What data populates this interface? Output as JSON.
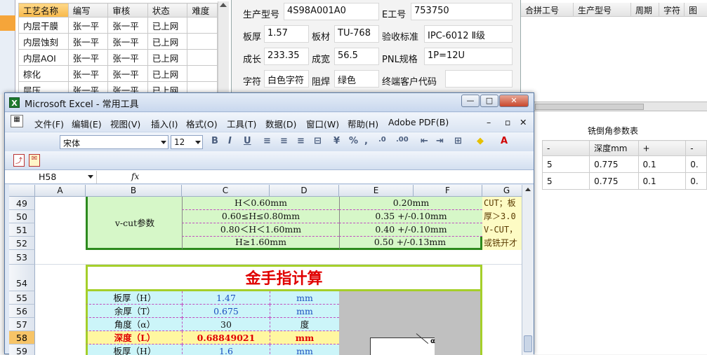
{
  "left_list": {
    "headers": [
      "工艺名称",
      "编写",
      "审核",
      "状态",
      "难度"
    ],
    "rows": [
      [
        "内层干膜",
        "张一平",
        "张一平",
        "已上网",
        ""
      ],
      [
        "内层蚀刻",
        "张一平",
        "张一平",
        "已上网",
        ""
      ],
      [
        "内层AOI",
        "张一平",
        "张一平",
        "已上网",
        ""
      ],
      [
        "棕化",
        "张一平",
        "张一平",
        "已上网",
        ""
      ],
      [
        "层压",
        "张一平",
        "张一平",
        "已上网",
        ""
      ]
    ]
  },
  "product_form": {
    "prod_no_label": "生产型号",
    "prod_no": "4S98A001A0",
    "e_no_label": "E工号",
    "e_no": "753750",
    "thickness_label": "板厚",
    "thickness": "1.57",
    "material_label": "板材",
    "material": "TU-768",
    "standard_label": "验收标准",
    "standard": "IPC-6012 Ⅱ级",
    "finished_label": "成长",
    "finished": "233.35",
    "width_label": "成宽",
    "width": "56.5",
    "pnl_label": "PNL规格",
    "pnl": "1P=12U",
    "char_label": "字符",
    "char": "白色字符",
    "mask_label": "阻焊",
    "mask": "绿色",
    "customer_label": "终端客户代码",
    "customer": ""
  },
  "right_panel": {
    "headers": [
      "合拼工号",
      "生产型号",
      "周期",
      "字符",
      "图"
    ],
    "table2_title": "铣倒角参数表",
    "table2_headers": [
      "-",
      "深度mm",
      "+",
      "-"
    ],
    "table2_rows": [
      [
        "5",
        "0.775",
        "0.1",
        "0."
      ],
      [
        "5",
        "0.775",
        "0.1",
        "0."
      ]
    ]
  },
  "excel": {
    "title": "Microsoft Excel - 常用工具",
    "menu": [
      "文件(F)",
      "编辑(E)",
      "视图(V)",
      "插入(I)",
      "格式(O)",
      "工具(T)",
      "数据(D)",
      "窗口(W)",
      "帮助(H)",
      "Adobe PDF(B)"
    ],
    "font": "宋体",
    "font_size": "12",
    "name_box": "H58",
    "fx": "fx",
    "cols": [
      "A",
      "B",
      "C",
      "D",
      "E",
      "F",
      "G"
    ],
    "rows": [
      "49",
      "50",
      "51",
      "52",
      "53",
      "54",
      "55",
      "56",
      "57",
      "58",
      "59"
    ],
    "vcut_label": "v-cut参数",
    "vcut": [
      [
        "H＜0.60mm",
        "0.20mm"
      ],
      [
        "0.60≤H≤0.80mm",
        "0.35 +/-0.10mm"
      ],
      [
        "0.80＜H＜1.60mm",
        "0.40 +/-0.10mm"
      ],
      [
        "H≥1.60mm",
        "0.50 +/-0.13mm"
      ]
    ],
    "note_lines": [
      "CUT；板",
      "厚＞3.0",
      "V-CUT，",
      "或铣开才"
    ],
    "gold_title": "金手指计算",
    "calc": [
      {
        "label": "板厚（H）",
        "value": "1.47",
        "unit": "mm"
      },
      {
        "label": "余厚（T）",
        "value": "0.675",
        "unit": "mm"
      },
      {
        "label": "角度（α）",
        "value": "30",
        "unit": "度"
      },
      {
        "label": "深度（L）",
        "value": "0.68849021",
        "unit": "mm"
      },
      {
        "label": "板厚（H）",
        "value": "1.6",
        "unit": "mm"
      }
    ],
    "alpha": "α"
  }
}
